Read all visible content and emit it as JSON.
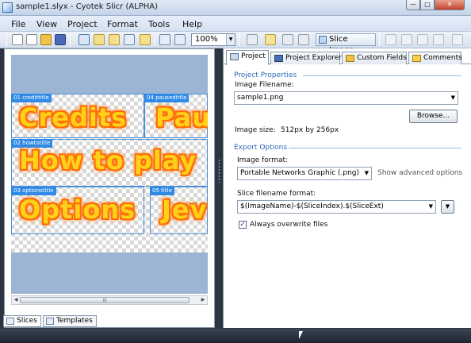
{
  "window": {
    "title": "sample1.slyx - Cyotek Slicr (ALPHA)",
    "minimize_glyph": "—",
    "maximize_glyph": "□",
    "close_glyph": "✕"
  },
  "menu": [
    "File",
    "View",
    "Project",
    "Format",
    "Tools",
    "Help"
  ],
  "toolbar": {
    "zoom_value": "100%",
    "slice_image_label": "Slice Image"
  },
  "canvas": {
    "slices": [
      {
        "tag": "01 credittitle",
        "word": "Credits"
      },
      {
        "tag": "04 pausedtitle",
        "word": "Pau"
      },
      {
        "tag": "02 howtotitle",
        "word": "How to play"
      },
      {
        "tag": "03 optionstitle",
        "word": "Options"
      },
      {
        "tag": "05 title",
        "word": "Jev"
      }
    ],
    "scroll_grip": "III"
  },
  "bottom_tabs": [
    "Slices",
    "Templates"
  ],
  "tabs": [
    "Project",
    "Project Explorer",
    "Custom Fields",
    "Comments"
  ],
  "project": {
    "properties_heading": "Project Properties",
    "image_filename_label": "Image Filename:",
    "image_filename_value": "sample1.png",
    "browse_label": "Browse...",
    "image_size_label": "Image size:",
    "image_size_value": "512px by 256px",
    "export_heading": "Export Options",
    "image_format_label": "Image format:",
    "image_format_value": "Portable Networks Graphic (.png)",
    "show_advanced_label": "Show advanced options",
    "slice_filename_label": "Slice filename format:",
    "slice_filename_value": "$(ImageName)-$(SliceIndex).$(SliceExt)",
    "overwrite_label": "Always overwrite files",
    "overwrite_checked": "✓"
  },
  "colors": {
    "accent": "#2e8ae6",
    "section_heading": "#2a6ab5",
    "glyph_fill": "#ffd11a",
    "glyph_glow": "#ff6a00"
  }
}
